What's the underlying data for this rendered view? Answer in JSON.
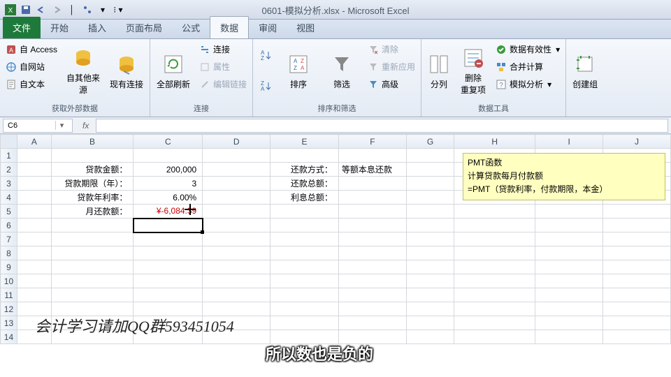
{
  "title": "0601-模拟分析.xlsx - Microsoft Excel",
  "tabs": {
    "file": "文件",
    "home": "开始",
    "insert": "插入",
    "layout": "页面布局",
    "formula": "公式",
    "data": "数据",
    "review": "审阅",
    "view": "视图"
  },
  "ribbon": {
    "ext": {
      "label": "获取外部数据",
      "access": "自 Access",
      "web": "自网站",
      "text": "自文本",
      "other": "自其他来源",
      "existing": "现有连接"
    },
    "conn": {
      "label": "连接",
      "refresh": "全部刷新",
      "c1": "连接",
      "c2": "属性",
      "c3": "编辑链接"
    },
    "sort": {
      "label": "排序和筛选",
      "sort": "排序",
      "filter": "筛选",
      "clear": "清除",
      "reapply": "重新应用",
      "adv": "高级"
    },
    "tools": {
      "label": "数据工具",
      "split": "分列",
      "dedup": "删除\n重复项",
      "valid": "数据有效性",
      "consol": "合并计算",
      "whatif": "模拟分析",
      "group": "创建组"
    }
  },
  "namebox": "C6",
  "cols": [
    "A",
    "B",
    "C",
    "D",
    "E",
    "F",
    "G",
    "H",
    "I",
    "J"
  ],
  "rows": {
    "2": {
      "B": "贷款金额：",
      "C": "200,000",
      "E": "还款方式：",
      "F": "等额本息还款"
    },
    "3": {
      "B": "贷款期限（年）：",
      "C": "3",
      "E": "还款总额："
    },
    "4": {
      "B": "贷款年利率：",
      "C": "6.00%",
      "E": "利息总额："
    },
    "5": {
      "B": "月还款额：",
      "C": "¥-6,084.39"
    }
  },
  "note": {
    "l1": "PMT函数",
    "l2": "计算贷款每月付款额",
    "l3": "=PMT（贷款利率，付款期限，本金）"
  },
  "overlay": "会计学习请加QQ群593451054",
  "subtitle": "所以数也是负的",
  "colw": {
    "A": 50,
    "B": 120,
    "C": 100,
    "D": 100,
    "E": 100,
    "F": 100,
    "G": 70,
    "H": 120,
    "I": 100,
    "J": 100
  }
}
